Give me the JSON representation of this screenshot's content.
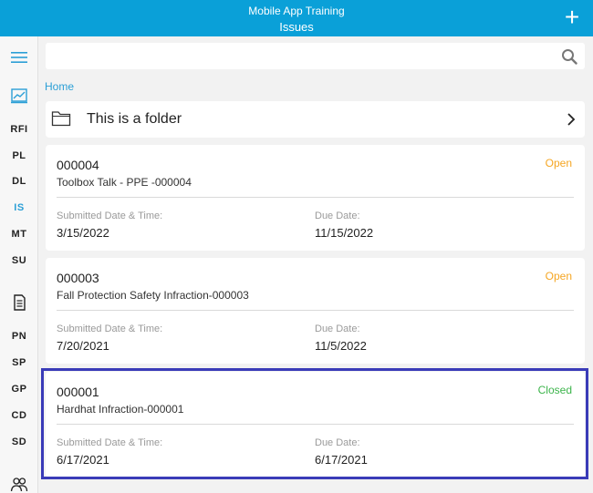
{
  "header": {
    "app_title": "Mobile App Training",
    "page_title": "Issues",
    "add_icon": "plus-icon"
  },
  "sidebar": {
    "items": [
      {
        "label": "RFI",
        "active": false
      },
      {
        "label": "PL",
        "active": false
      },
      {
        "label": "DL",
        "active": false
      },
      {
        "label": "IS",
        "active": true
      },
      {
        "label": "MT",
        "active": false
      },
      {
        "label": "SU",
        "active": false
      },
      {
        "label": "PN",
        "active": false
      },
      {
        "label": "SP",
        "active": false
      },
      {
        "label": "GP",
        "active": false
      },
      {
        "label": "CD",
        "active": false
      },
      {
        "label": "SD",
        "active": false
      }
    ],
    "icons": [
      "hamburger-menu-icon",
      "dashboard-chart-icon",
      "document-icon",
      "people-group-icon"
    ]
  },
  "search": {
    "placeholder": "",
    "icon": "search-icon"
  },
  "breadcrumb": {
    "home": "Home"
  },
  "folder": {
    "label": "This is a folder",
    "icon": "folder-icon"
  },
  "issues": [
    {
      "number": "000004",
      "title": "Toolbox Talk  - PPE -000004",
      "status": "Open",
      "submitted_label": "Submitted Date & Time:",
      "submitted": "3/15/2022",
      "due_label": "Due Date:",
      "due": "11/15/2022"
    },
    {
      "number": "000003",
      "title": "Fall Protection Safety Infraction-000003",
      "status": "Open",
      "submitted_label": "Submitted Date & Time:",
      "submitted": "7/20/2021",
      "due_label": "Due Date:",
      "due": "11/5/2022"
    },
    {
      "number": "000001",
      "title": "Hardhat Infraction-000001",
      "status": "Closed",
      "submitted_label": "Submitted Date & Time:",
      "submitted": "6/17/2021",
      "due_label": "Due Date:",
      "due": "6/17/2021"
    }
  ],
  "colors": {
    "header": "#0aa0d8",
    "accent": "#2b9fd6",
    "open": "#f5a623",
    "closed": "#3cb44b",
    "highlight": "#3a3bb8"
  }
}
